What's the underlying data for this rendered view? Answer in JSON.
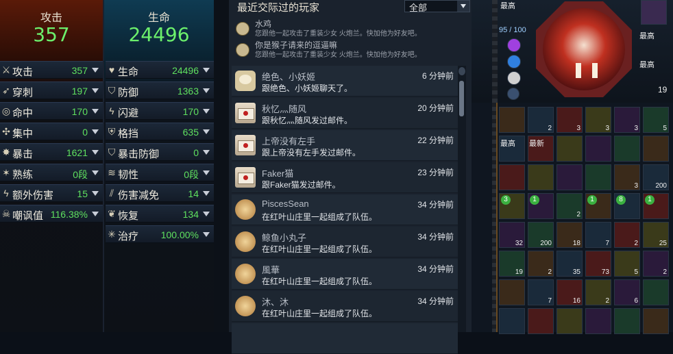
{
  "attack": {
    "title": "攻击",
    "value": "357"
  },
  "health": {
    "title": "生命",
    "value": "24496"
  },
  "attack_stats": [
    {
      "label": "攻击",
      "value": "357"
    },
    {
      "label": "穿刺",
      "value": "197"
    },
    {
      "label": "命中",
      "value": "170"
    },
    {
      "label": "集中",
      "value": "0"
    },
    {
      "label": "暴击",
      "value": "1621"
    },
    {
      "label": "熟练",
      "value": "0段"
    },
    {
      "label": "额外伤害",
      "value": "15"
    },
    {
      "label": "嘲讽值",
      "value": "116.38%"
    }
  ],
  "defense_stats": [
    {
      "label": "生命",
      "value": "24496"
    },
    {
      "label": "防御",
      "value": "1363"
    },
    {
      "label": "闪避",
      "value": "170"
    },
    {
      "label": "格挡",
      "value": "635"
    },
    {
      "label": "暴击防御",
      "value": "0"
    },
    {
      "label": "韧性",
      "value": "0段"
    },
    {
      "label": "伤害减免",
      "value": "14"
    },
    {
      "label": "恢复",
      "value": "134"
    },
    {
      "label": "治疗",
      "value": "100.00%"
    }
  ],
  "list": {
    "title": "最近交际过的玩家",
    "filter": "全部",
    "notices": [
      {
        "name": "水鸡",
        "msg": "您跟他一起攻击了重装少女 火炮兰。快加他为好友吧。"
      },
      {
        "name": "你是猴子请来的逗逼嘛",
        "msg": "您跟他一起攻击了重装少女 火炮兰。快加他为好友吧。"
      }
    ],
    "rows": [
      {
        "name": "绝色、小妖姬",
        "msg": "跟绝色、小妖姬聊天了。",
        "time": "6 分钟前",
        "icon": "chat"
      },
      {
        "name": "秋忆灬随风",
        "msg": "跟秋忆灬随风发过邮件。",
        "time": "20 分钟前",
        "icon": "mail"
      },
      {
        "name": "上帝没有左手",
        "msg": "跟上帝没有左手发过邮件。",
        "time": "22 分钟前",
        "icon": "mail"
      },
      {
        "name": "Faker猫",
        "msg": "跟Faker猫发过邮件。",
        "time": "23 分钟前",
        "icon": "mail"
      },
      {
        "name": "PiscesSean",
        "msg": "在红叶山庄里一起组成了队伍。",
        "time": "34 分钟前",
        "icon": "hand"
      },
      {
        "name": "鲸鱼小丸子",
        "msg": "在红叶山庄里一起组成了队伍。",
        "time": "34 分钟前",
        "icon": "hand"
      },
      {
        "name": "風華",
        "msg": "在红叶山庄里一起组成了队伍。",
        "time": "34 分钟前",
        "icon": "hand"
      },
      {
        "name": "沐、沐",
        "msg": "在红叶山庄里一起组成了队伍。",
        "time": "34 分钟前",
        "icon": "hand"
      }
    ]
  },
  "inventory": {
    "top": {
      "best1": "最高",
      "gauge": "95 / 100",
      "best2": "最高",
      "best3": "最高",
      "count": "19"
    },
    "rows": [
      [
        {
          "q": ""
        },
        {
          "q": "2"
        },
        {
          "q": "3"
        },
        {
          "q": "3"
        },
        {
          "q": "3"
        },
        {
          "q": "5"
        }
      ],
      [
        {
          "lbl": "最高"
        },
        {
          "lbl": "最新"
        },
        {
          "q": ""
        },
        {
          "q": ""
        },
        {
          "q": ""
        },
        {
          "q": ""
        }
      ],
      [
        {
          "q": ""
        },
        {
          "q": ""
        },
        {
          "q": ""
        },
        {
          "q": ""
        },
        {
          "q": "3"
        },
        {
          "q": "200"
        }
      ],
      [
        {
          "b": "3"
        },
        {
          "b": "1"
        },
        {
          "q": "2"
        },
        {
          "b": "1"
        },
        {
          "b": "8"
        },
        {
          "b": "1"
        }
      ],
      [
        {
          "q": "32"
        },
        {
          "q": "200"
        },
        {
          "q": "18"
        },
        {
          "q": "7"
        },
        {
          "q": "2"
        },
        {
          "q": "25"
        }
      ],
      [
        {
          "q": "19"
        },
        {
          "q": "2"
        },
        {
          "q": "35"
        },
        {
          "q": "73"
        },
        {
          "q": "5"
        },
        {
          "q": "2"
        }
      ],
      [
        {
          "q": ""
        },
        {
          "q": "7"
        },
        {
          "q": "16"
        },
        {
          "q": "2"
        },
        {
          "q": "6"
        },
        {
          "q": ""
        }
      ],
      [
        {
          "q": ""
        },
        {
          "q": ""
        },
        {
          "q": ""
        },
        {
          "q": ""
        },
        {
          "q": ""
        },
        {
          "q": ""
        }
      ]
    ]
  }
}
